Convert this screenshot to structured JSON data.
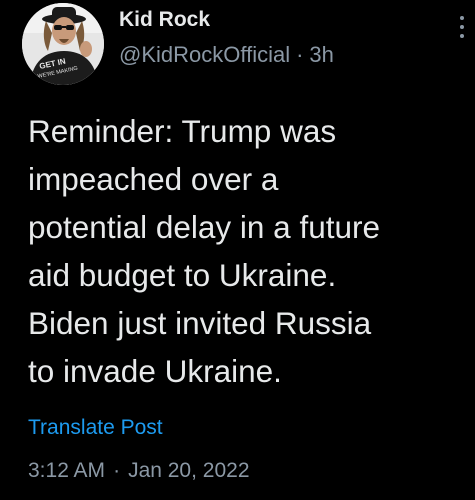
{
  "author": {
    "display_name": "Kid Rock",
    "handle": "@KidRockOfficial",
    "separator": "·",
    "relative_time": "3h",
    "avatar_shirt_text": "GET IN WE'RE MAKING"
  },
  "post": {
    "lines": [
      "Reminder: Trump was",
      "impeached over a",
      "potential delay in a future",
      "aid budget to Ukraine.",
      "Biden just invited Russia",
      "to invade Ukraine."
    ],
    "translate_label": "Translate Post",
    "time": "3:12 AM",
    "separator": "·",
    "date": "Jan 20, 2022"
  },
  "colors": {
    "background": "#000000",
    "text": "#e7e9ea",
    "secondary_text": "#8b98a5",
    "link": "#1d9bf0"
  },
  "icons": {
    "more": "more-icon"
  }
}
